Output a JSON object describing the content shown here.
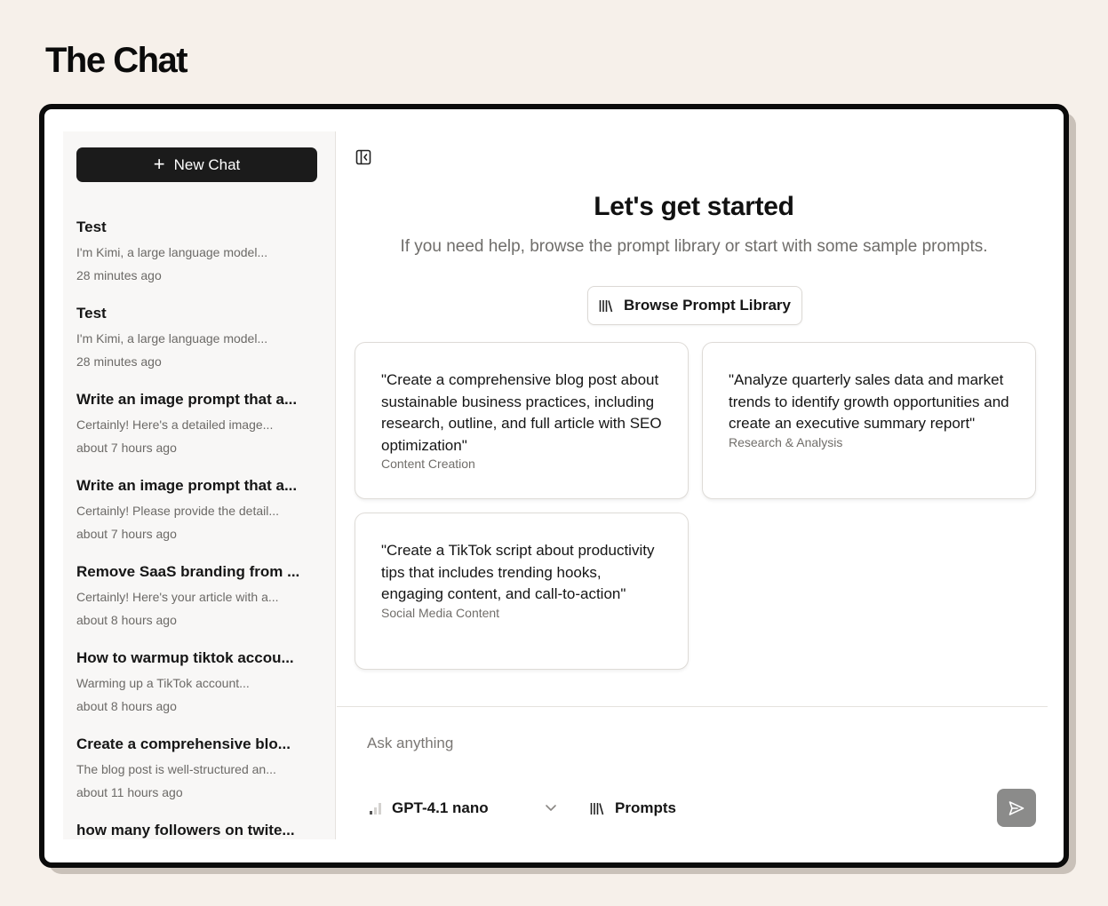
{
  "page": {
    "title": "The Chat"
  },
  "sidebar": {
    "new_chat_label": "New Chat",
    "chats": [
      {
        "title": "Test",
        "preview": "I'm Kimi, a large language model...",
        "time": "28 minutes ago"
      },
      {
        "title": "Test",
        "preview": "I'm Kimi, a large language model...",
        "time": "28 minutes ago"
      },
      {
        "title": "Write an image prompt that a...",
        "preview": "Certainly! Here's a detailed image...",
        "time": "about 7 hours ago"
      },
      {
        "title": "Write an image prompt that a...",
        "preview": "Certainly! Please provide the detail...",
        "time": "about 7 hours ago"
      },
      {
        "title": "Remove SaaS branding from ...",
        "preview": "Certainly! Here's your article with a...",
        "time": "about 8 hours ago"
      },
      {
        "title": "How to warmup tiktok accou...",
        "preview": "Warming up a TikTok account...",
        "time": "about 8 hours ago"
      },
      {
        "title": "Create a comprehensive blo...",
        "preview": "The blog post is well-structured an...",
        "time": "about 11 hours ago"
      },
      {
        "title": "how many followers on twite...",
        "preview": "",
        "time": ""
      }
    ]
  },
  "main": {
    "headline": "Let's get started",
    "subline": "If you need help, browse the prompt library or start with some sample prompts.",
    "browse_label": "Browse Prompt Library",
    "cards": [
      {
        "text": "\"Create a comprehensive blog post about sustainable business practices, including research, outline, and full article with SEO optimization\"",
        "category": "Content Creation"
      },
      {
        "text": "\"Analyze quarterly sales data and market trends to identify growth opportunities and create an executive summary report\"",
        "category": "Research & Analysis"
      },
      {
        "text": "\"Create a TikTok script about productivity tips that includes trending hooks, engaging content, and call-to-action\"",
        "category": "Social Media Content"
      }
    ],
    "composer": {
      "placeholder": "Ask anything",
      "model": "GPT-4.1 nano",
      "prompts_label": "Prompts"
    }
  },
  "colors": {
    "background": "#f6f0ea",
    "button_dark": "#1b1b1b",
    "send_button": "#8b8b8a"
  },
  "icons": {
    "new_chat": "plus-icon",
    "collapse": "sidebar-collapse-icon",
    "library": "library-icon",
    "model": "signal-bars-icon",
    "dropdown": "chevron-down-icon",
    "send": "send-icon"
  }
}
